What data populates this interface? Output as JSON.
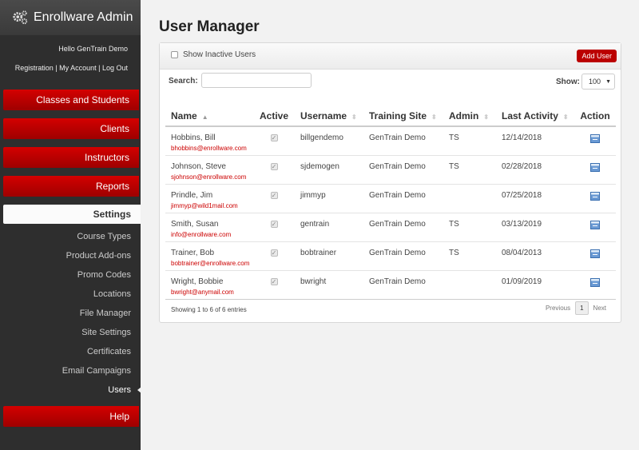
{
  "app": {
    "title": "Enrollware Admin",
    "brand_icon": "gears-icon"
  },
  "user": {
    "greeting": "Hello GenTrain Demo"
  },
  "account_links": [
    "Registration",
    "My Account",
    "Log Out"
  ],
  "nav": {
    "main": [
      "Classes and Students",
      "Clients",
      "Instructors",
      "Reports"
    ],
    "settings_label": "Settings",
    "settings_items": [
      "Course Types",
      "Product Add-ons",
      "Promo Codes",
      "Locations",
      "File Manager",
      "Site Settings",
      "Certificates",
      "Email Campaigns",
      "Users"
    ],
    "active_item": "Users",
    "help_label": "Help"
  },
  "page": {
    "title": "User Manager"
  },
  "toolbar": {
    "show_inactive_label": "Show Inactive Users",
    "add_user_label": "Add User",
    "search_label": "Search:",
    "search_value": "",
    "show_label": "Show:",
    "show_value": "100"
  },
  "table": {
    "columns": [
      "Name",
      "Active",
      "Username",
      "Training Site",
      "Admin",
      "Last Activity",
      "Action"
    ],
    "rows": [
      {
        "name": "Hobbins, Bill",
        "email": "bhobbins@enrollware.com",
        "username": "billgendemo",
        "site": "GenTrain Demo",
        "admin": "TS",
        "last_activity": "12/14/2018"
      },
      {
        "name": "Johnson, Steve",
        "email": "sjohnson@enrollware.com",
        "username": "sjdemogen",
        "site": "GenTrain Demo",
        "admin": "TS",
        "last_activity": "02/28/2018"
      },
      {
        "name": "Prindle, Jim",
        "email": "jimmyp@wild1mail.com",
        "username": "jimmyp",
        "site": "GenTrain Demo",
        "admin": "",
        "last_activity": "07/25/2018"
      },
      {
        "name": "Smith, Susan",
        "email": "info@enrollware.com",
        "username": "gentrain",
        "site": "GenTrain Demo",
        "admin": "TS",
        "last_activity": "03/13/2019"
      },
      {
        "name": "Trainer, Bob",
        "email": "bobtrainer@enrollware.com",
        "username": "bobtrainer",
        "site": "GenTrain Demo",
        "admin": "TS",
        "last_activity": "08/04/2013"
      },
      {
        "name": "Wright, Bobbie",
        "email": "bwright@anymail.com",
        "username": "bwright",
        "site": "GenTrain Demo",
        "admin": "",
        "last_activity": "01/09/2019"
      }
    ]
  },
  "footer": {
    "info": "Showing 1 to 6 of 6 entries",
    "previous": "Previous",
    "page": "1",
    "next": "Next"
  },
  "colors": {
    "accent_red": "#b00000",
    "sidebar_bg": "#2e2e2e",
    "link_red": "#cc0000"
  }
}
